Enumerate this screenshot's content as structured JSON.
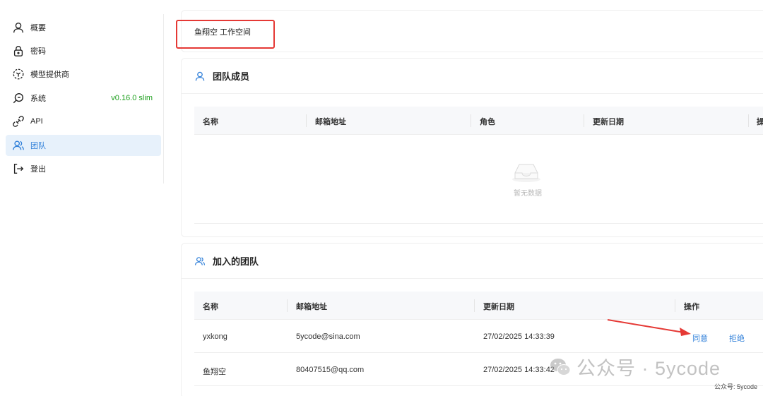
{
  "sidebar": {
    "items": [
      {
        "label": "概要",
        "icon": "user-icon"
      },
      {
        "label": "密码",
        "icon": "lock-icon"
      },
      {
        "label": "模型提供商",
        "icon": "model-provider-icon"
      },
      {
        "label": "系统",
        "icon": "system-icon",
        "version": "v0.16.0 slim"
      },
      {
        "label": "API",
        "icon": "api-icon"
      },
      {
        "label": "团队",
        "icon": "team-icon",
        "active": true
      },
      {
        "label": "登出",
        "icon": "logout-icon"
      }
    ]
  },
  "workspace": {
    "title": "鱼翔空 工作空间"
  },
  "team_members": {
    "title": "团队成员",
    "columns": [
      "名称",
      "邮箱地址",
      "角色",
      "更新日期",
      "操"
    ],
    "empty_text": "暂无数据"
  },
  "joined_teams": {
    "title": "加入的团队",
    "columns": [
      "名称",
      "邮箱地址",
      "更新日期",
      "操作"
    ],
    "rows": [
      {
        "name": "yxkong",
        "email": "5ycode@sina.com",
        "updated": "27/02/2025 14:33:39",
        "actions": [
          "同意",
          "拒绝"
        ]
      },
      {
        "name": "鱼翔空",
        "email": "80407515@qq.com",
        "updated": "27/02/2025 14:33:42",
        "actions": []
      }
    ]
  },
  "watermark": {
    "text": "公众号 · 5ycode",
    "caption": "公众号: 5ycode"
  },
  "colors": {
    "accent": "#2f7fd9",
    "active_bg": "#e7f1fb",
    "version_green": "#21a121",
    "highlight_red": "#e53935"
  }
}
